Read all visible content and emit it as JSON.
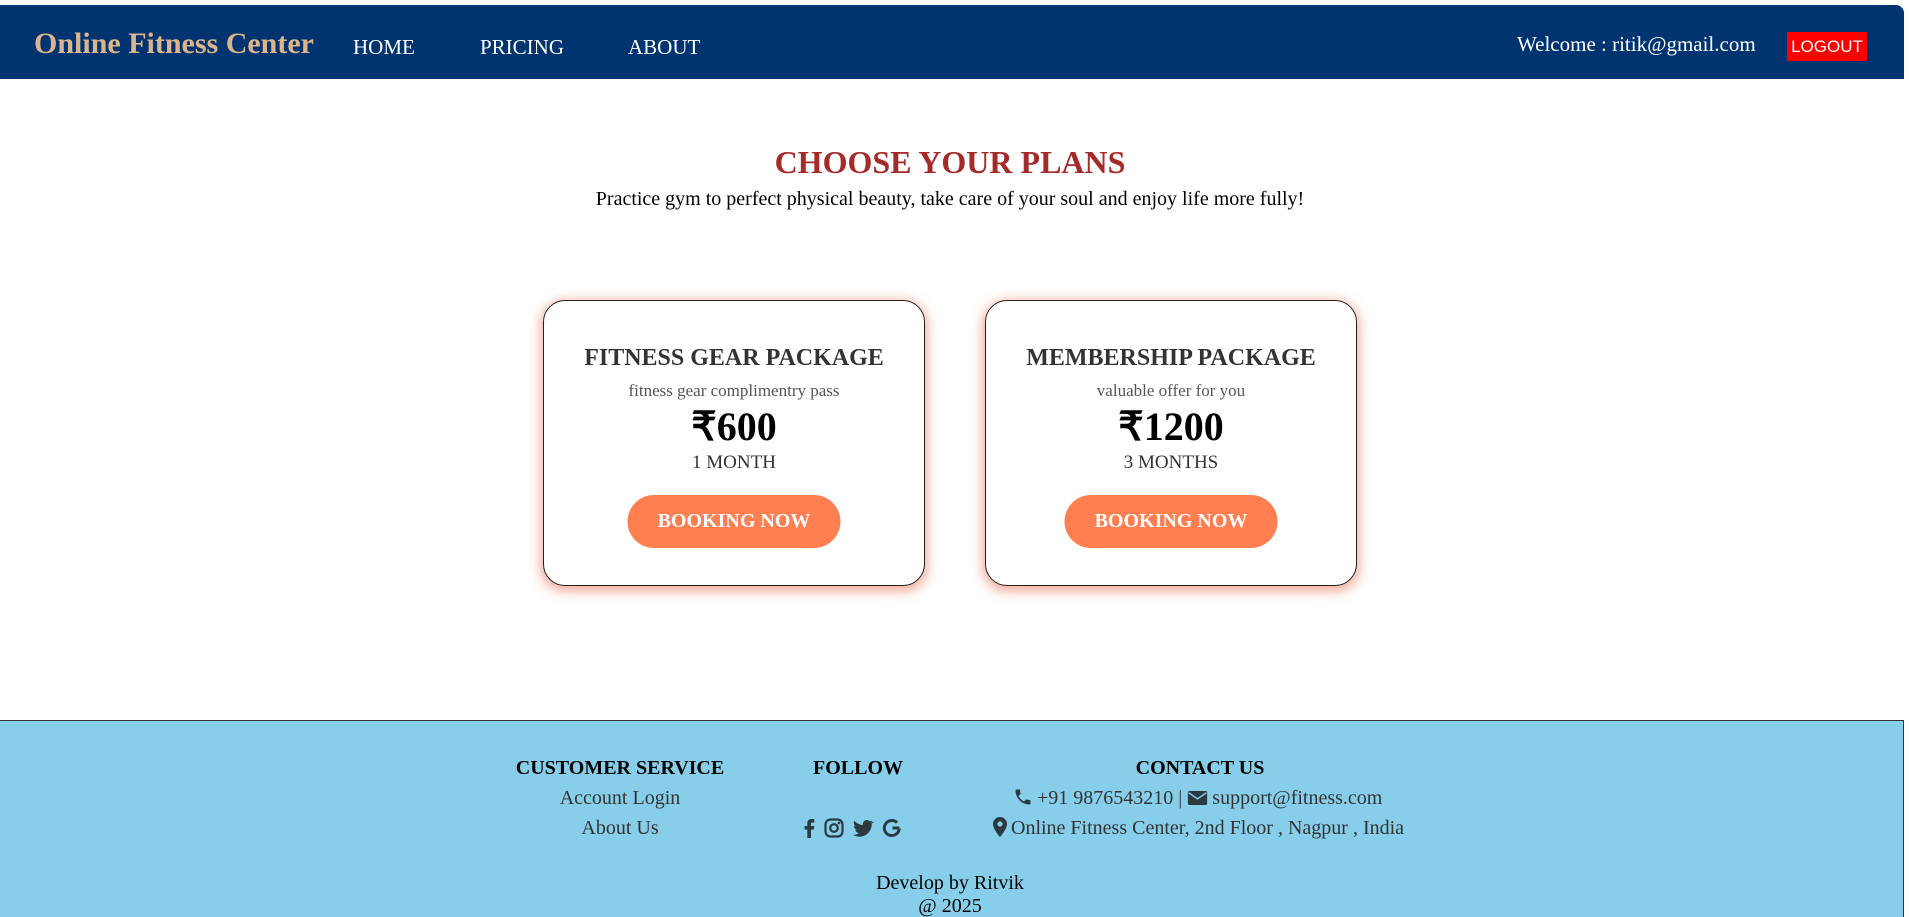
{
  "header": {
    "brand": "Online Fitness Center",
    "nav": [
      "HOME",
      "PRICING",
      "ABOUT"
    ],
    "welcome": "Welcome : ritik@gmail.com",
    "logout_label": "LOGOUT"
  },
  "plans": {
    "title": "CHOOSE YOUR PLANS",
    "subtitle": "Practice gym to perfect physical beauty, take care of your soul and enjoy life more fully!",
    "cards": [
      {
        "title": "FITNESS GEAR PACKAGE",
        "description": "fitness gear complimentry pass",
        "price": "₹600",
        "duration": "1 MONTH",
        "button_label": "BOOKING NOW"
      },
      {
        "title": "MEMBERSHIP PACKAGE",
        "description": "valuable offer for you",
        "price": "₹1200",
        "duration": "3 MONTHS",
        "button_label": "BOOKING NOW"
      }
    ]
  },
  "footer": {
    "customer_service": {
      "heading": "CUSTOMER SERVICE",
      "links": [
        "Account Login",
        "About Us"
      ]
    },
    "follow": {
      "heading": "FOLLOW",
      "icons": [
        "facebook-icon",
        "instagram-icon",
        "twitter-icon",
        "google-icon"
      ]
    },
    "contact": {
      "heading": "CONTACT US",
      "phone": "+91 9876543210",
      "separator": "|",
      "email": "support@fitness.com",
      "address": "Online Fitness Center, 2nd Floor , Nagpur , India"
    },
    "credit": "Develop by Ritvik",
    "copyright": "@ 2025"
  },
  "colors": {
    "navbar": "#003470",
    "brand": "#dcb58d",
    "logout": "#ff0000",
    "title": "#a52a2a",
    "button": "#ff7f50",
    "footer": "#87ceeb"
  }
}
